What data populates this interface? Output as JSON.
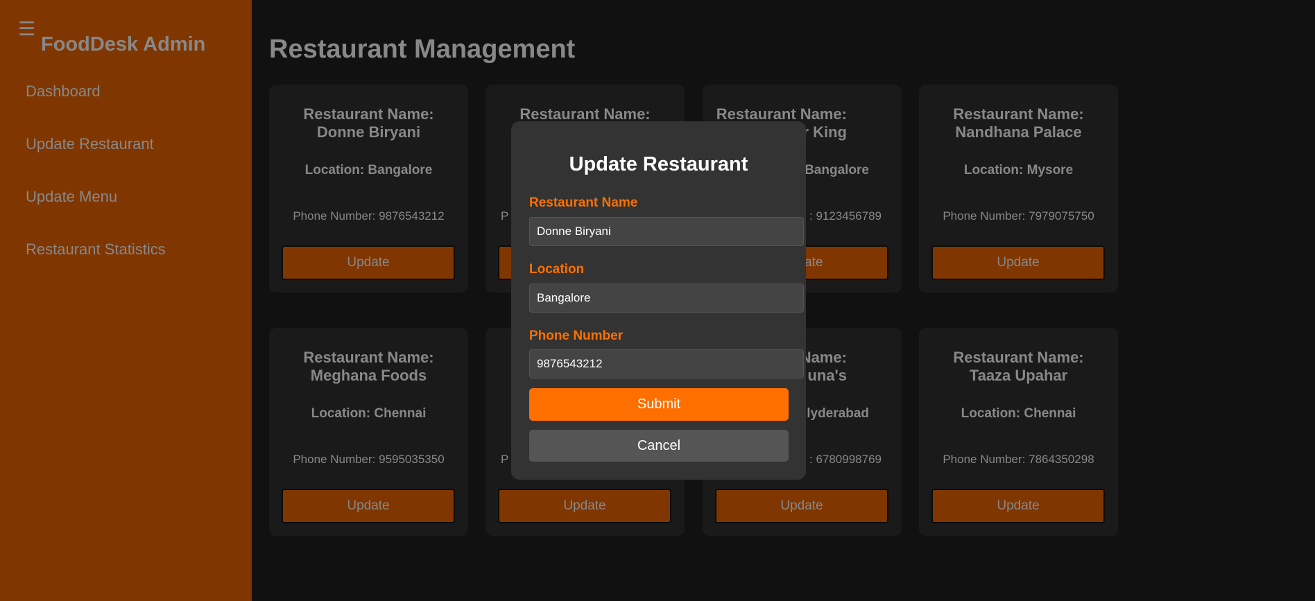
{
  "sidebar": {
    "menu_icon": "☰",
    "brand": "FoodDesk Admin",
    "items": [
      {
        "label": "Dashboard"
      },
      {
        "label": "Update Restaurant"
      },
      {
        "label": "Update Menu"
      },
      {
        "label": "Restaurant Statistics"
      }
    ]
  },
  "page_title": "Restaurant Management",
  "cards": [
    {
      "name1": "Restaurant Name:",
      "name2": "Donne Biryani",
      "location": "Location: Bangalore",
      "phone": "Phone Number: 9876543212",
      "button": "Update"
    },
    {
      "name1": "Restaurant Name:",
      "name2": "",
      "location": "",
      "phone": "P",
      "button": "Update"
    },
    {
      "name1": "Restaurant Name:",
      "name2": "r King",
      "location": "Bangalore",
      "phone": ": 9123456789",
      "button": "Update"
    },
    {
      "name1": "Restaurant Name:",
      "name2": "Nandhana Palace",
      "location": "Location: Mysore",
      "phone": "Phone Number: 7979075750",
      "button": "Update"
    },
    {
      "name1": "Restaurant Name:",
      "name2": "Meghana Foods",
      "location": "Location: Chennai",
      "phone": "Phone Number: 9595035350",
      "button": "Update"
    },
    {
      "name1": "",
      "name2": "",
      "location": "",
      "phone": "P",
      "button": "Update"
    },
    {
      "name1": "nt Name:",
      "name2": "una's",
      "location": "lyderabad",
      "phone": ": 6780998769",
      "button": "Update"
    },
    {
      "name1": "Restaurant Name:",
      "name2": "Taaza Upahar",
      "location": "Location: Chennai",
      "phone": "Phone Number: 7864350298",
      "button": "Update"
    }
  ],
  "modal": {
    "title": "Update Restaurant",
    "name_label": "Restaurant Name",
    "name_value": "Donne Biryani",
    "location_label": "Location",
    "location_value": "Bangalore",
    "phone_label": "Phone Number",
    "phone_value": "9876543212",
    "submit": "Submit",
    "cancel": "Cancel"
  },
  "colors": {
    "accent": "#ff6f00",
    "sidebar": "#7f3600",
    "modal": "#333333"
  }
}
